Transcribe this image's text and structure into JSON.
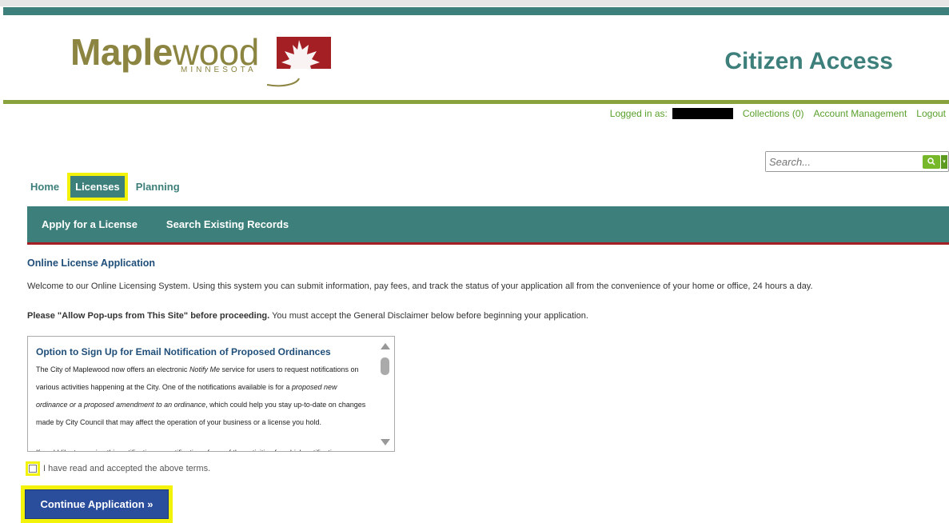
{
  "header": {
    "logo_main": "Maple",
    "logo_rest": "wood",
    "logo_sub": "MINNESOTA",
    "title": "Citizen Access"
  },
  "user_bar": {
    "logged_in_label": "Logged in as:",
    "collections": "Collections (0)",
    "account": "Account Management",
    "logout": "Logout"
  },
  "search": {
    "placeholder": "Search..."
  },
  "nav": {
    "home": "Home",
    "licenses": "Licenses",
    "planning": "Planning"
  },
  "subnav": {
    "apply": "Apply for a License",
    "search_records": "Search Existing Records"
  },
  "content": {
    "title": "Online License Application",
    "welcome": "Welcome to our Online Licensing System. Using this system you can submit information, pay fees, and track the status of your application all from the convenience of your home or office, 24 hours a day.",
    "popups_bold": "Please \"Allow Pop-ups from This Site\" before proceeding.",
    "popups_rest": " You must accept the General Disclaimer below before beginning your application."
  },
  "disclaimer": {
    "heading": "Option to Sign Up for Email Notification of Proposed Ordinances",
    "body_1": "The City of Maplewood now offers an electronic ",
    "notify_me": "Notify Me",
    "body_2": " service for users to request notifications on various activities happening at the City. One of the notifications available is for a ",
    "italic_1": "proposed new ordinance or a proposed amendment to an ordinance",
    "body_3": ", which could help you stay up-to-date on changes made by City Council that may affect the operation of your business or a license you hold.",
    "body_cut": "If you'd like to receive this notification, or notification of any of the activities for which notifications"
  },
  "agree": {
    "label": "I have read and accepted the above terms."
  },
  "continue": {
    "label": "Continue Application »"
  },
  "colors": {
    "teal": "#3d7f7a",
    "green": "#5aa02c",
    "olive": "#8aa23b",
    "red": "#a31f23",
    "button_blue": "#2a4d9c",
    "highlight": "#f2f20a"
  }
}
